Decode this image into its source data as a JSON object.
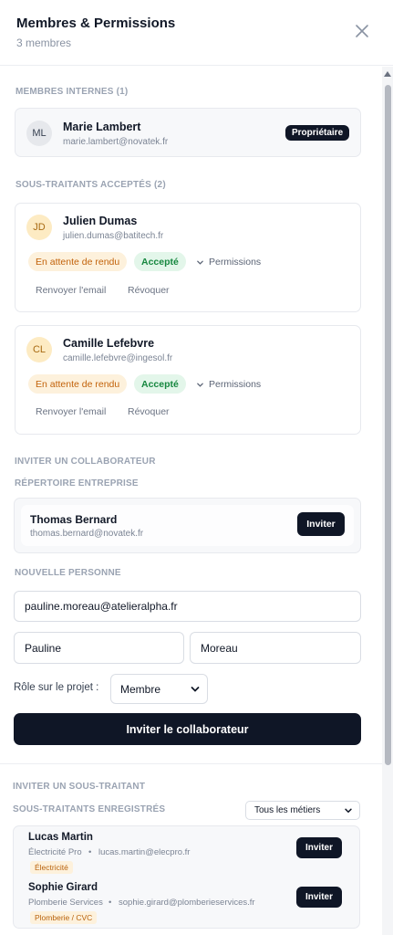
{
  "header": {
    "title": "Membres & Permissions",
    "subtitle": "3 membres"
  },
  "internal": {
    "section_label": "MEMBRES INTERNES (1)",
    "members": [
      {
        "initials": "ML",
        "name": "Marie Lambert",
        "email": "marie.lambert@novatek.fr",
        "role_badge": "Propriétaire"
      }
    ]
  },
  "subcontractors": {
    "section_label": "SOUS-TRAITANTS ACCEPTÉS (2)",
    "members": [
      {
        "initials": "JD",
        "name": "Julien Dumas",
        "email": "julien.dumas@batitech.fr",
        "status_waiting": "En attente de rendu",
        "status_accepted": "Accepté",
        "permissions_label": "Permissions",
        "resend_label": "Renvoyer l'email",
        "revoke_label": "Révoquer"
      },
      {
        "initials": "CL",
        "name": "Camille Lefebvre",
        "email": "camille.lefebvre@ingesol.fr",
        "status_waiting": "En attente de rendu",
        "status_accepted": "Accepté",
        "permissions_label": "Permissions",
        "resend_label": "Renvoyer l'email",
        "revoke_label": "Révoquer"
      }
    ]
  },
  "invite_collaborator": {
    "section_label": "INVITER UN COLLABORATEUR",
    "directory_label": "RÉPERTOIRE ENTREPRISE",
    "directory": [
      {
        "name": "Thomas Bernard",
        "email": "thomas.bernard@novatek.fr",
        "invite_label": "Inviter"
      }
    ],
    "new_person_label": "NOUVELLE PERSONNE",
    "email_value": "pauline.moreau@atelieralpha.fr",
    "first_name_value": "Pauline",
    "last_name_value": "Moreau",
    "role_label": "Rôle sur le projet :",
    "role_value": "Membre",
    "submit_label": "Inviter le collaborateur"
  },
  "invite_subcontractor": {
    "section_label": "INVITER UN SOUS-TRAITANT",
    "registered_label": "SOUS-TRAITANTS ENREGISTRÉS",
    "filter_value": "Tous les métiers",
    "items": [
      {
        "name": "Lucas Martin",
        "company": "Électricité Pro",
        "separator": "•",
        "email": "lucas.martin@elecpro.fr",
        "trade": "Électricité",
        "invite_label": "Inviter"
      },
      {
        "name": "Sophie Girard",
        "company": "Plomberie Services",
        "separator": "•",
        "email": "sophie.girard@plomberieservices.fr",
        "trade": "Plomberie / CVC",
        "invite_label": "Inviter"
      }
    ]
  },
  "icons": {
    "close": "close-icon",
    "chevron": "chevron-down-icon"
  },
  "colors": {
    "dark": "#0f1626",
    "waiting_bg": "#fdf1dc",
    "waiting_text": "#c2620a",
    "accepted_bg": "#e3f6ea",
    "accepted_text": "#16873f",
    "avatar_yellow": "#fdebc3"
  }
}
